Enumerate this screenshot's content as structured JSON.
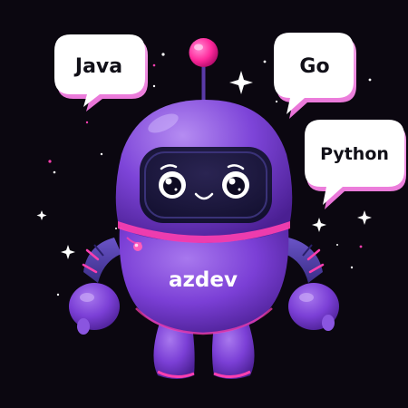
{
  "illustration": {
    "subject": "robot-mascot",
    "robot_label": "azdev",
    "speech_bubbles": [
      {
        "text": "Java"
      },
      {
        "text": "Go"
      },
      {
        "text": "Python"
      }
    ],
    "colors": {
      "background": "#0b0710",
      "robot_body": "#7b3fd6",
      "robot_highlight": "#a878ee",
      "robot_shadow": "#4d2196",
      "accent_pink": "#ff3fb0",
      "visor": "#1a1537",
      "bubble_fill": "#ffffff",
      "bubble_shadow": "#e86fd6"
    }
  }
}
